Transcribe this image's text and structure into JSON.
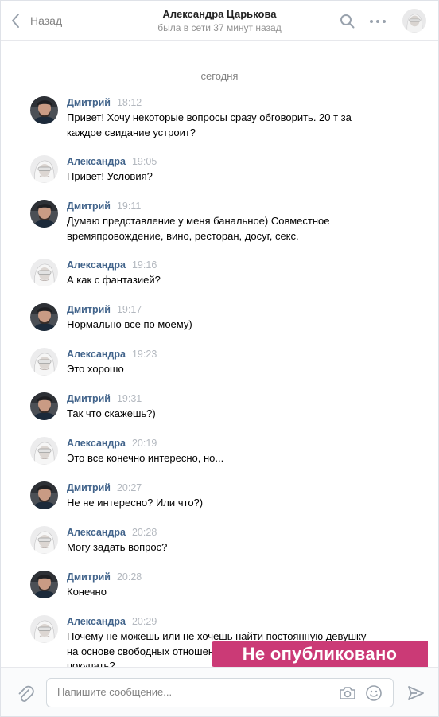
{
  "header": {
    "back_label": "Назад",
    "peer_name": "Александра Царькова",
    "peer_status": "была в сети 37 минут назад"
  },
  "chat": {
    "day_separator": "сегодня",
    "messages": [
      {
        "author": "Дмитрий",
        "time": "18:12",
        "lines": [
          "Привет! Хочу некоторые вопросы сразу обговорить. 20 т за",
          "каждое свидание устроит?"
        ],
        "avatar": "dmitry"
      },
      {
        "author": "Александра",
        "time": "19:05",
        "lines": [
          "Привет! Условия?"
        ],
        "avatar": "alexandra"
      },
      {
        "author": "Дмитрий",
        "time": "19:11",
        "lines": [
          "Думаю представление у меня банальное) Совместное",
          "времяпровождение, вино, ресторан, досуг, секс."
        ],
        "avatar": "dmitry"
      },
      {
        "author": "Александра",
        "time": "19:16",
        "lines": [
          "А как с фантазией?"
        ],
        "avatar": "alexandra"
      },
      {
        "author": "Дмитрий",
        "time": "19:17",
        "lines": [
          "Нормально все по моему)"
        ],
        "avatar": "dmitry"
      },
      {
        "author": "Александра",
        "time": "19:23",
        "lines": [
          "Это хорошо"
        ],
        "avatar": "alexandra"
      },
      {
        "author": "Дмитрий",
        "time": "19:31",
        "lines": [
          "Так что скажешь?)"
        ],
        "avatar": "dmitry"
      },
      {
        "author": "Александра",
        "time": "20:19",
        "lines": [
          "Это все конечно интересно, но..."
        ],
        "avatar": "alexandra"
      },
      {
        "author": "Дмитрий",
        "time": "20:27",
        "lines": [
          "Не не интересно? Или что?)"
        ],
        "avatar": "dmitry"
      },
      {
        "author": "Александра",
        "time": "20:28",
        "lines": [
          "Могу задать вопрос?"
        ],
        "avatar": "alexandra"
      },
      {
        "author": "Дмитрий",
        "time": "20:28",
        "lines": [
          "Конечно"
        ],
        "avatar": "dmitry"
      },
      {
        "author": "Александра",
        "time": "20:29",
        "lines": [
          "Почему не можешь или не хочешь найти постоянную девушку",
          "на основе свободных отношений, зачем",
          "покупать?"
        ],
        "avatar": "alexandra"
      }
    ]
  },
  "overlay_badge": "Не опубликовано",
  "composer": {
    "placeholder": "Напишите сообщение..."
  },
  "colors": {
    "author": "#42648b",
    "time": "#b3b8bf",
    "badge": "#cb3a76",
    "muted": "#828282"
  },
  "icons": [
    "chevron-left-icon",
    "search-icon",
    "more-dots-icon",
    "paperclip-icon",
    "camera-icon",
    "smile-icon",
    "send-icon"
  ]
}
